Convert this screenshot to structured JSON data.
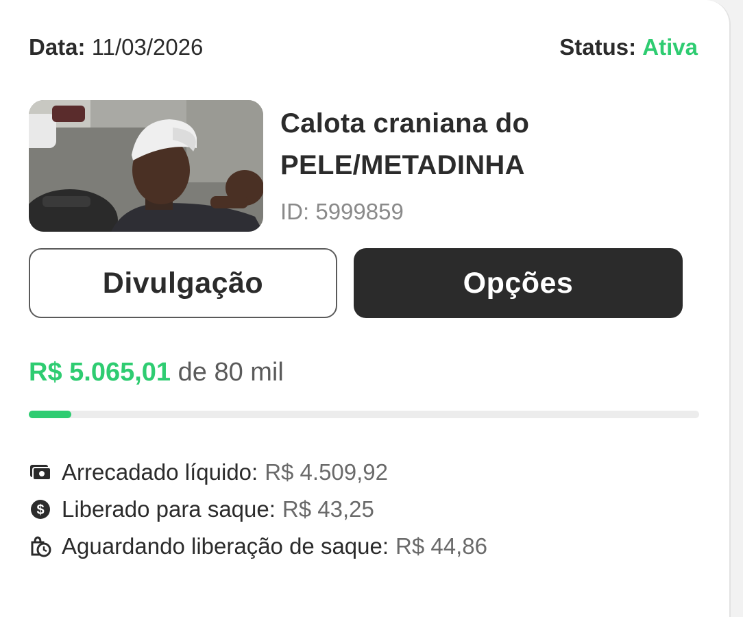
{
  "header": {
    "date_label": "Data:",
    "date_value": "11/03/2026",
    "status_label": "Status:",
    "status_value": "Ativa",
    "status_color": "#2ecc71"
  },
  "campaign": {
    "thumbnail_icon": "campaign-photo",
    "title_line1": "Calota craniana do",
    "title_line2": "PELE/METADINHA",
    "id_text": "ID: 5999859"
  },
  "actions": {
    "share_label": "Divulgação",
    "options_label": "Opções"
  },
  "progress": {
    "raised": "R$ 5.065,01",
    "goal_text": "de 80 mil",
    "fraction": 0.0633
  },
  "stats": [
    {
      "icon": "money-icon",
      "label": "Arrecadado líquido:",
      "value": "R$ 4.509,92"
    },
    {
      "icon": "dollar-coin-icon",
      "label": "Liberado para saque:",
      "value": "R$ 43,25"
    },
    {
      "icon": "bag-clock-icon",
      "label": "Aguardando liberação de saque:",
      "value": "R$ 44,86"
    }
  ],
  "colors": {
    "accent_green": "#2ecc71",
    "dark": "#2b2b2b"
  }
}
